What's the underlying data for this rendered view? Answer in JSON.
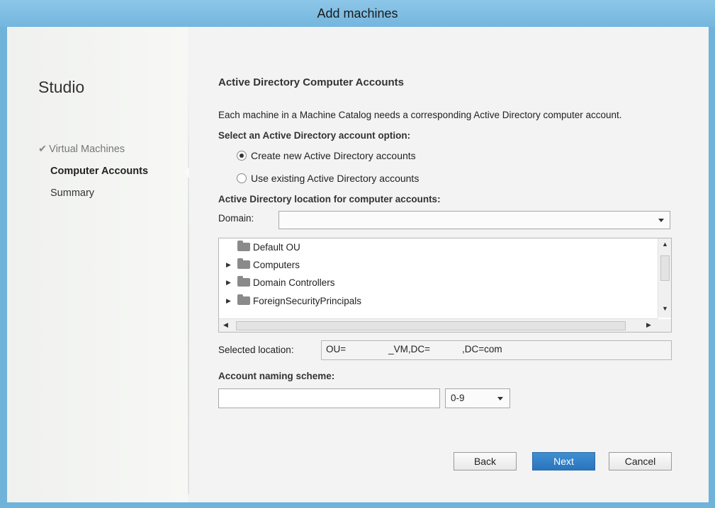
{
  "window": {
    "title": "Add machines"
  },
  "nav": {
    "brand": "Studio",
    "items": [
      {
        "label": "Virtual Machines",
        "state": "done",
        "check": "✔"
      },
      {
        "label": "Computer Accounts",
        "state": "active"
      },
      {
        "label": "Summary",
        "state": "pending"
      }
    ]
  },
  "main": {
    "heading": "Active Directory Computer Accounts",
    "description": "Each machine in a Machine Catalog needs a corresponding Active Directory computer account.",
    "option_label": "Select an Active Directory account option:",
    "radio_options": [
      {
        "label": "Create new Active Directory accounts",
        "selected": true
      },
      {
        "label": "Use existing Active Directory accounts",
        "selected": false
      }
    ],
    "location_label": "Active Directory location for computer accounts:",
    "domain_label": "Domain:",
    "domain_value": "",
    "tree_items": [
      {
        "label": "Default OU",
        "icon": "default-ou-icon",
        "expandable": false
      },
      {
        "label": "Computers",
        "icon": "folder-icon",
        "expandable": true
      },
      {
        "label": "Domain Controllers",
        "icon": "folder-icon",
        "expandable": true
      },
      {
        "label": "ForeignSecurityPrincipals",
        "icon": "folder-icon",
        "expandable": true
      }
    ],
    "selected_location_label": "Selected location:",
    "selected_location_value": "OU=                _VM,DC=            ,DC=com",
    "naming_label": "Account naming scheme:",
    "naming_value": "",
    "naming_option": "0-9"
  },
  "buttons": {
    "back": "Back",
    "next": "Next",
    "cancel": "Cancel"
  },
  "colors": {
    "title_bar": "#74b6df",
    "primary_button": "#2a74bd",
    "window_bg": "#f2f3f2"
  }
}
